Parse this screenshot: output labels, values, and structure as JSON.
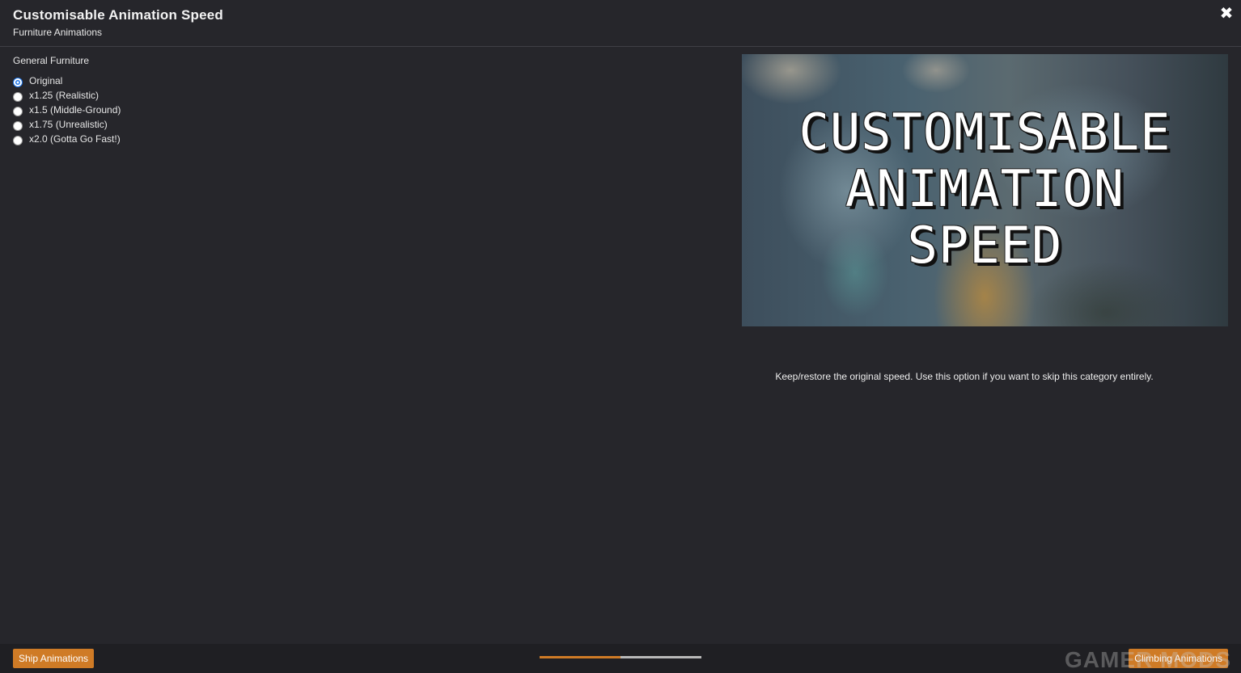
{
  "header": {
    "title": "Customisable Animation Speed",
    "subtitle": "Furniture Animations",
    "close_icon": "close-icon"
  },
  "group": {
    "title": "General Furniture",
    "selected_index": 0,
    "options": [
      {
        "label": "Original",
        "checked": true
      },
      {
        "label": "x1.25 (Realistic)",
        "checked": false
      },
      {
        "label": "x1.5 (Middle-Ground)",
        "checked": false
      },
      {
        "label": "x1.75 (Unrealistic)",
        "checked": false
      },
      {
        "label": "x2.0 (Gotta Go Fast!)",
        "checked": false
      }
    ]
  },
  "preview": {
    "line1": "CUSTOMISABLE",
    "line2": "ANIMATION",
    "line3": "SPEED"
  },
  "description": "Keep/restore the original speed. Use this option if you want to skip this category entirely.",
  "footer": {
    "prev_label": "Ship Animations",
    "next_label": "Climbing Animations",
    "progress_fraction": 0.5,
    "watermark": "GAMER MODS"
  },
  "colors": {
    "accent": "#cf7b26",
    "background": "#26262b",
    "radio_selected": "#1a73e8"
  }
}
